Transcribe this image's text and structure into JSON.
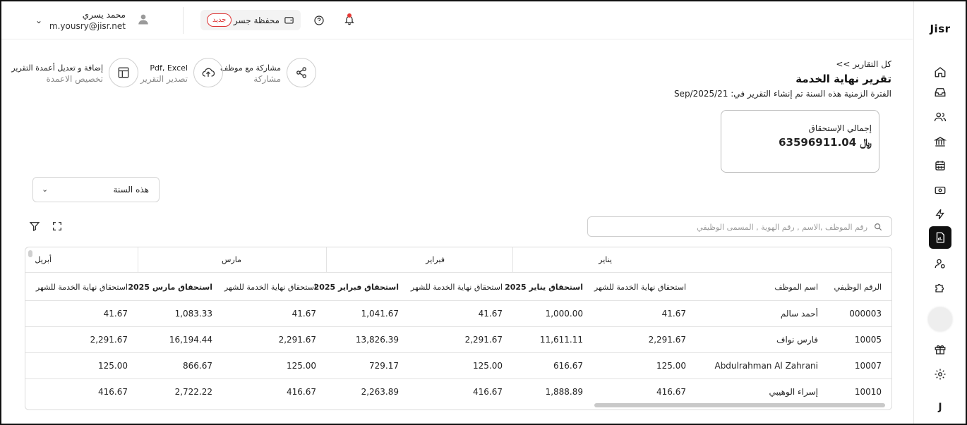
{
  "brand": {
    "logo_text": "Jisr"
  },
  "header": {
    "user_name": "محمد يسري",
    "user_email": "m.yousry@jisr.net",
    "wallet_label": "محفظة جسر",
    "new_badge": "جديد"
  },
  "actions": {
    "share_title": "مشاركة مع موظف",
    "share_sub": "مشاركة",
    "export_title": "Pdf, Excel",
    "export_sub": "تصدير التقرير",
    "columns_title": "إضافة و تعديل أعمدة التقرير",
    "columns_sub": "تخصيص الاعمدة"
  },
  "report": {
    "back_link": "<< كل التقارير",
    "title": "تقرير نهاية الخدمة",
    "period_line": "الفترة الزمنية هذه السنة تم إنشاء التقرير في: Sep/2025/21",
    "total_label": "إجمالي الإستحقاق",
    "total_value": "63596911.04",
    "currency_symbol": "﷼"
  },
  "filters": {
    "period_value": "هذه السنة",
    "search_placeholder": "رقم الموظف ,الاسم , رقم الهوية , المسمى الوظيفي"
  },
  "table": {
    "groups": [
      "يناير",
      "فبراير",
      "مارس",
      "أبريل"
    ],
    "headers": {
      "emp_id": "الرقم الوظيفي",
      "emp_name": "اسم الموظف",
      "jan_monthly": "استحقاق نهاية الخدمة للشهر",
      "jan_total": "استحقاق يناير 2025",
      "feb_monthly": "استحقاق نهاية الخدمة للشهر",
      "feb_total": "استحقاق فبراير 2025",
      "mar_monthly": "استحقاق نهاية الخدمة للشهر",
      "mar_total": "استحقاق مارس 2025",
      "apr_monthly": "استحقاق نهاية الخدمة للشهر"
    },
    "rows": [
      {
        "id": "000003",
        "name": "أحمد سالم",
        "jan_m": "41.67",
        "jan_t": "1,000.00",
        "feb_m": "41.67",
        "feb_t": "1,041.67",
        "mar_m": "41.67",
        "mar_t": "1,083.33",
        "apr_m": "41.67"
      },
      {
        "id": "10005",
        "name": "فارس نواف",
        "jan_m": "2,291.67",
        "jan_t": "11,611.11",
        "feb_m": "2,291.67",
        "feb_t": "13,826.39",
        "mar_m": "2,291.67",
        "mar_t": "16,194.44",
        "apr_m": "2,291.67"
      },
      {
        "id": "10007",
        "name": "Abdulrahman Al Zahrani",
        "jan_m": "125.00",
        "jan_t": "616.67",
        "feb_m": "125.00",
        "feb_t": "729.17",
        "mar_m": "125.00",
        "mar_t": "866.67",
        "apr_m": "125.00"
      },
      {
        "id": "10010",
        "name": "إسراء الوهيبي",
        "jan_m": "416.67",
        "jan_t": "1,888.89",
        "feb_m": "416.67",
        "feb_t": "2,263.89",
        "mar_m": "416.67",
        "mar_t": "2,722.22",
        "apr_m": "416.67"
      }
    ]
  }
}
